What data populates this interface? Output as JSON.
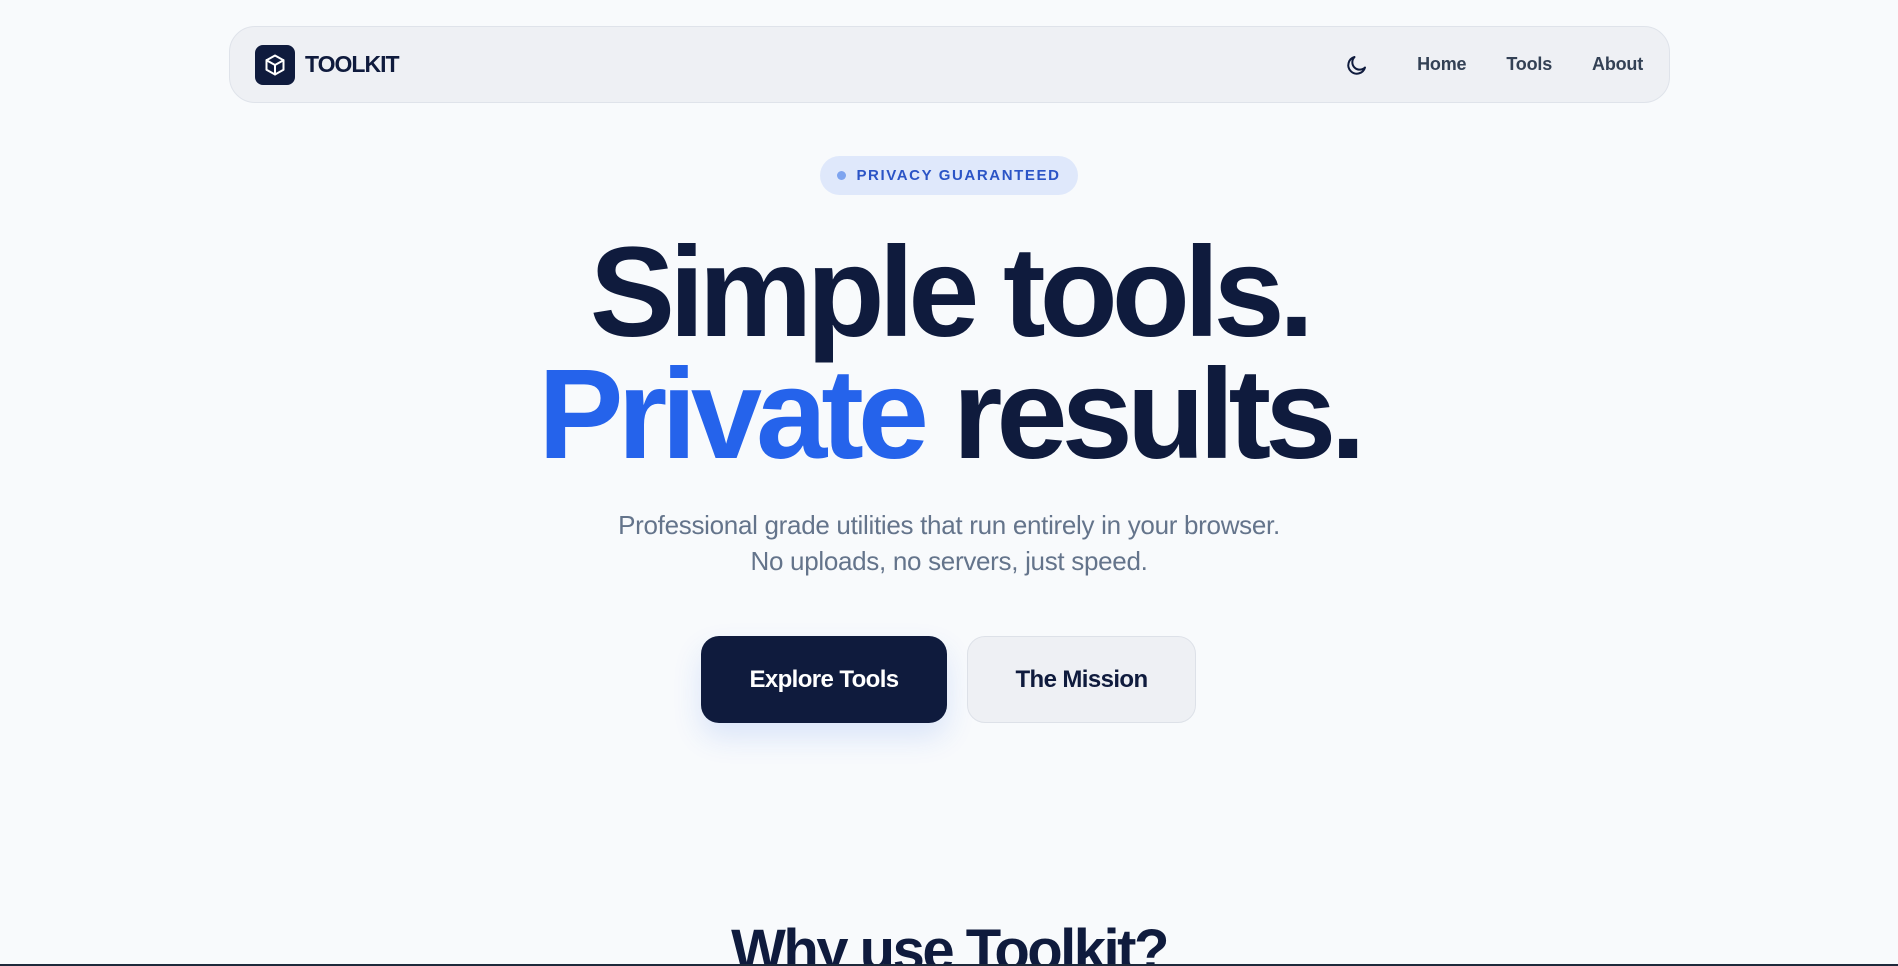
{
  "brand": {
    "name": "TOOLKIT",
    "logo_icon": "cube-icon"
  },
  "nav": {
    "theme_toggle_icon": "moon-icon",
    "links": [
      {
        "label": "Home"
      },
      {
        "label": "Tools"
      },
      {
        "label": "About"
      }
    ]
  },
  "hero": {
    "badge": "PRIVACY GUARANTEED",
    "headline_line1": "Simple tools.",
    "headline_line2_accent": "Private",
    "headline_line2_rest": " results.",
    "subtitle_line1": "Professional grade utilities that run entirely in your browser.",
    "subtitle_line2": "No uploads, no servers, just speed.",
    "primary_cta": "Explore Tools",
    "secondary_cta": "The Mission"
  },
  "section": {
    "title": "Why use Toolkit?"
  },
  "colors": {
    "background": "#f8fafc",
    "navy": "#0f1b3d",
    "accent": "#2563eb",
    "badge_bg": "#dfe8fb",
    "badge_text": "#2b54c6",
    "muted_text": "#64748b"
  }
}
